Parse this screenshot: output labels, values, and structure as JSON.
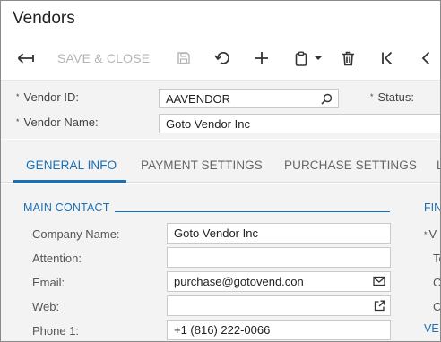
{
  "page": {
    "title": "Vendors"
  },
  "toolbar": {
    "back_icon": "arrow-left-icon",
    "save_close_label": "SAVE & CLOSE",
    "save_icon": "floppy-disk-icon",
    "undo_icon": "undo-icon",
    "add_icon": "plus-icon",
    "clipboard_icon": "clipboard-icon",
    "delete_icon": "trash-icon",
    "first_icon": "first-record-icon",
    "prev_icon": "chevron-left-icon"
  },
  "summary": {
    "vendor_id_label": "Vendor ID:",
    "vendor_id_value": "AAVENDOR",
    "status_label": "Status:",
    "vendor_name_label": "Vendor Name:",
    "vendor_name_value": "Goto Vendor Inc",
    "required_marker": "*"
  },
  "tabs": [
    {
      "label": "GENERAL INFO",
      "active": true
    },
    {
      "label": "PAYMENT SETTINGS",
      "active": false
    },
    {
      "label": "PURCHASE SETTINGS",
      "active": false
    },
    {
      "label": "L",
      "active": false
    }
  ],
  "main_contact": {
    "title": "MAIN CONTACT",
    "fields": [
      {
        "label": "Company Name:",
        "value": "Goto Vendor Inc"
      },
      {
        "label": "Attention:",
        "value": ""
      },
      {
        "label": "Email:",
        "value": "purchase@gotovend.con"
      },
      {
        "label": "Web:",
        "value": ""
      },
      {
        "label": "Phone 1:",
        "value": "+1 (816) 222-0066"
      }
    ]
  },
  "right_column": {
    "section_title_fragment": "FIN",
    "row1_fragment": "V",
    "row2_fragment": "Te",
    "row3_fragment": "C",
    "row4_fragment": "C",
    "section2_fragment": "VE"
  },
  "colors": {
    "accent": "#1a6fb5",
    "panel": "#f3f3f3",
    "disabled": "#b4b4b4"
  }
}
